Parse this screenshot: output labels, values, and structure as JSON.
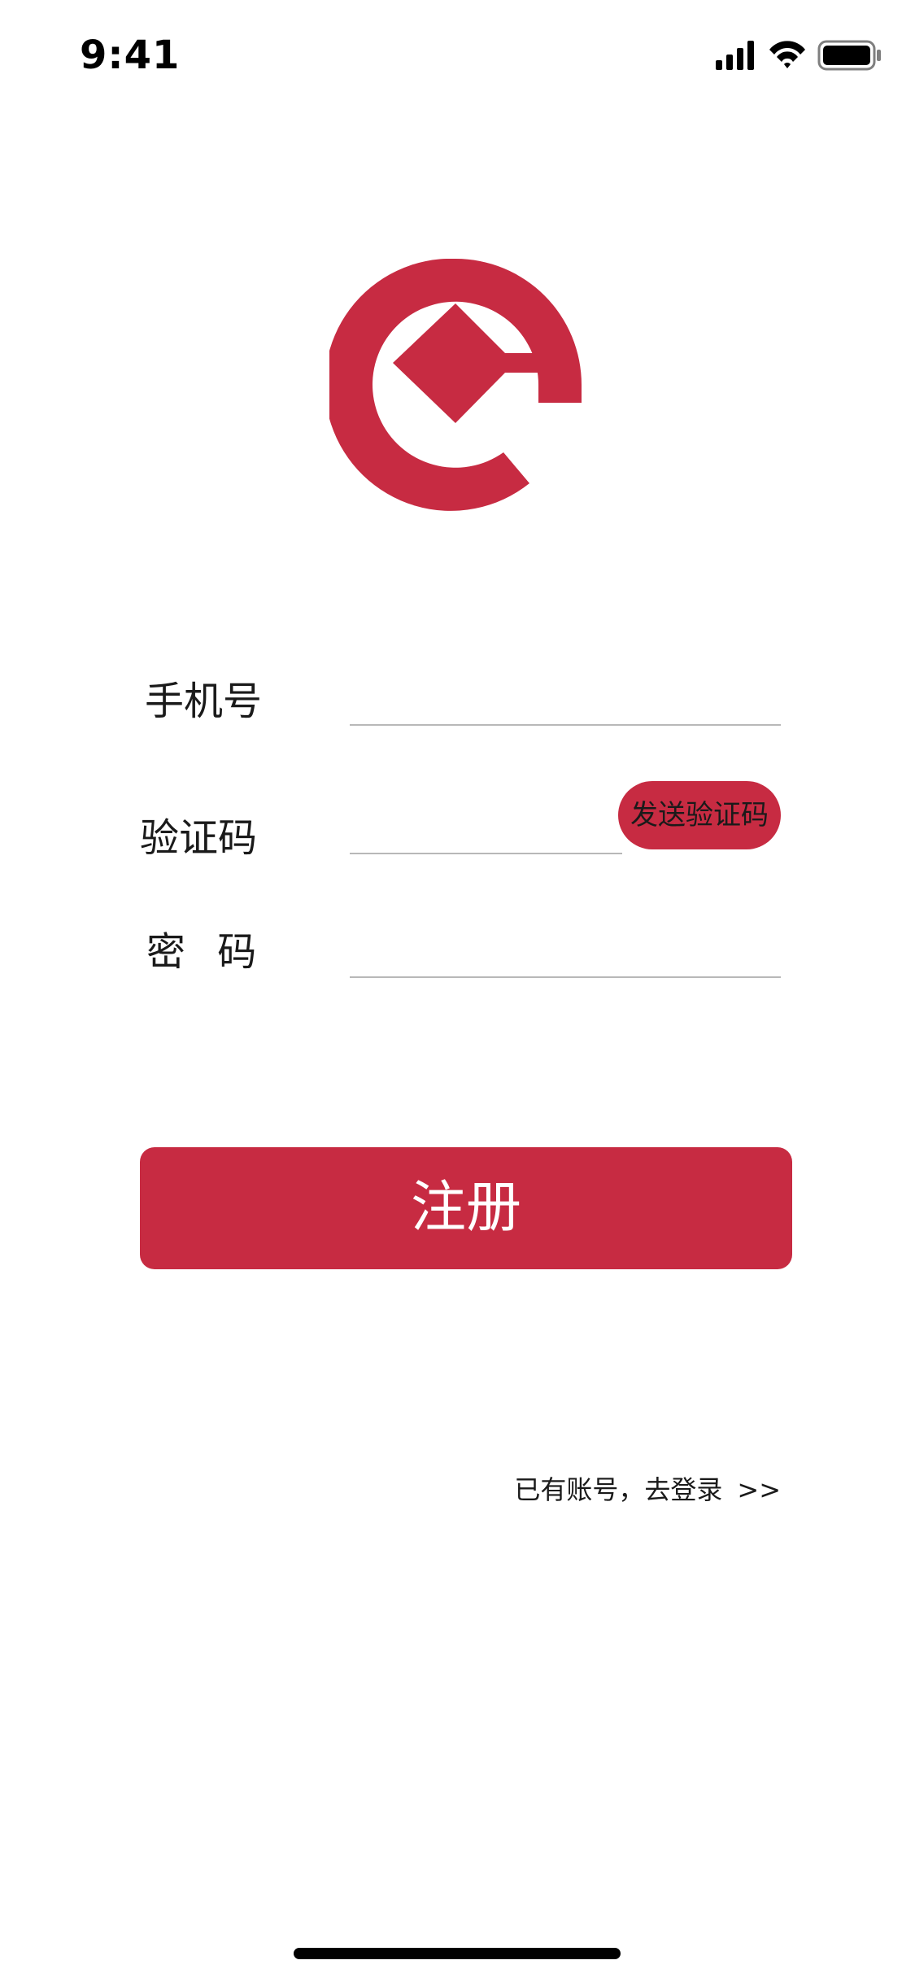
{
  "status_bar": {
    "time": "9:41"
  },
  "icons": {
    "signal": "signal-icon",
    "wifi": "wifi-icon",
    "battery": "battery-icon",
    "logo": "bank-e-logo-icon"
  },
  "colors": {
    "brand_red": "#c72b42",
    "divider": "#b8b8b8",
    "text": "#1a1a1a"
  },
  "form": {
    "phone": {
      "label": "手机号",
      "value": ""
    },
    "code": {
      "label": "验证码",
      "value": "",
      "send_button": "发送验证码"
    },
    "password": {
      "label": "密 码",
      "value": ""
    }
  },
  "register_button": "注册",
  "login_link": {
    "text": "已有账号，去登录",
    "arrow": ">>"
  }
}
